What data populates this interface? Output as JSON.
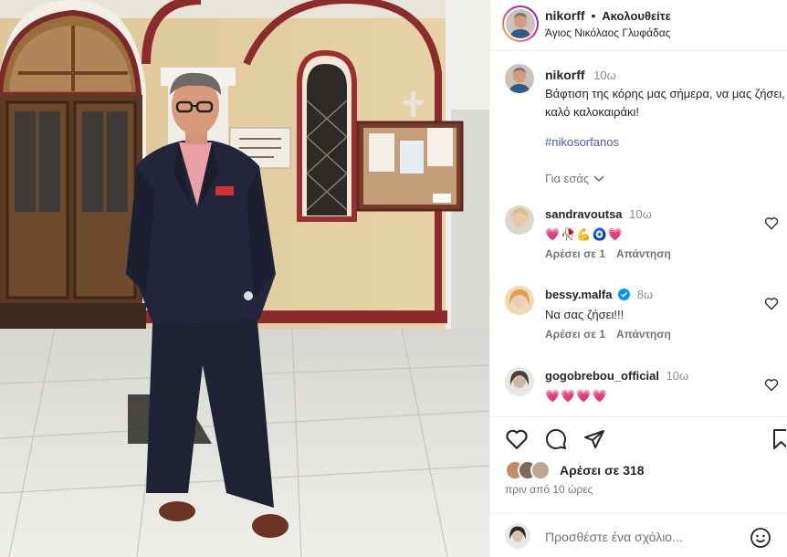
{
  "post": {
    "username": "nikorff",
    "follow_status": "Ακολουθείτε",
    "separator": "•",
    "location": "Άγιος Νικόλαος Γλυφάδας"
  },
  "caption": {
    "username": "nikorff",
    "time": "10ω",
    "text": "Βάφτιση της κόρης μας σήμερα, να μας ζήσει, καλό καλοκαιράκι!",
    "hashtag": "#nikosorfanos",
    "for_you": "Για εσάς"
  },
  "comments": [
    {
      "username": "sandravoutsa",
      "time": "10ω",
      "text": "💗🥀💪🧿💗",
      "likes": "Αρέσει σε 1",
      "reply": "Απάντηση"
    },
    {
      "username": "bessy.malfa",
      "time": "8ω",
      "text": "Να σας ζήσει!!!",
      "likes": "Αρέσει σε 1",
      "reply": "Απάντηση"
    },
    {
      "username": "gogobrebou_official",
      "time": "10ω",
      "text": "💗💗💗💗",
      "likes": "",
      "reply": ""
    }
  ],
  "actions": {
    "likes_text": "Αρέσει σε 318",
    "posted_ago": "πριν από 10 ώρες"
  },
  "composer": {
    "placeholder": "Προσθέστε ένα σχόλιο..."
  },
  "colors": {
    "link": "#4e5bbf",
    "muted": "#737373",
    "verified": "#0095f6"
  }
}
